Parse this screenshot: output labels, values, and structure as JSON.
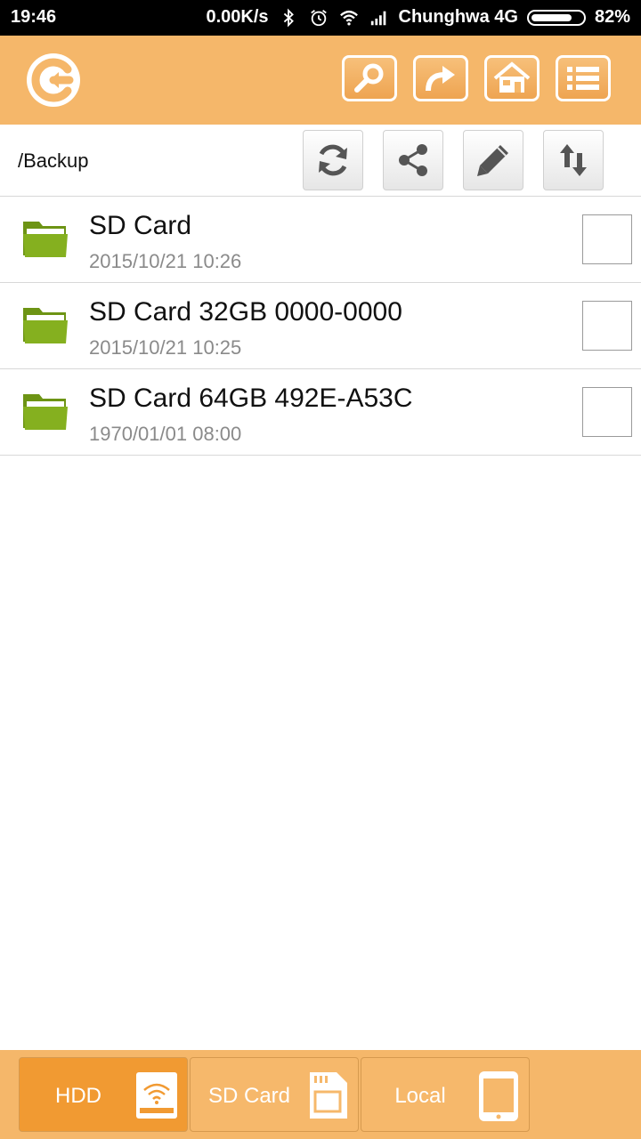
{
  "status": {
    "time": "19:46",
    "net_speed": "0.00K/s",
    "carrier": "Chunghwa 4G",
    "battery": "82%"
  },
  "toolbar": {
    "back_icon": "back-arrow-icon",
    "buttons": [
      "search-icon",
      "forward-share-icon",
      "home-icon",
      "list-icon"
    ]
  },
  "path": {
    "current": "/Backup",
    "actions": [
      "refresh-icon",
      "share-icon",
      "edit-icon",
      "sort-icon"
    ]
  },
  "files": [
    {
      "name": "SD Card",
      "date": "2015/10/21 10:26"
    },
    {
      "name": "SD Card 32GB 0000-0000",
      "date": "2015/10/21 10:25"
    },
    {
      "name": "SD Card 64GB 492E-A53C",
      "date": "1970/01/01 08:00"
    }
  ],
  "tabs": [
    {
      "label": "HDD",
      "icon": "wifi-hdd-icon",
      "active": true
    },
    {
      "label": "SD Card",
      "icon": "sd-card-icon",
      "active": false
    },
    {
      "label": "Local",
      "icon": "phone-icon",
      "active": false
    }
  ],
  "colors": {
    "accent": "#f5b76a",
    "active_tab": "#f19a32",
    "folder": "#7fa61c"
  }
}
